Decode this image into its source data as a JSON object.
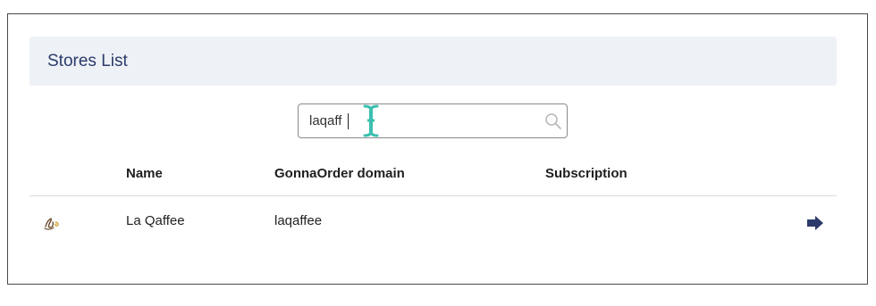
{
  "header": {
    "title": "Stores List"
  },
  "search": {
    "value": "laqaff",
    "placeholder": "",
    "icon": "search-icon"
  },
  "table": {
    "columns": [
      "",
      "Name",
      "GonnaOrder domain",
      "Subscription",
      ""
    ],
    "rows": [
      {
        "logo": "store-logo",
        "name": "La Qaffee",
        "domain": "laqaffee",
        "subscription": "",
        "action_icon": "arrow-right-icon"
      }
    ]
  },
  "colors": {
    "header_bg": "#eef2f6",
    "header_text": "#2b3a6b",
    "arrow": "#2b3a6b",
    "cursor": "#3bbfb0"
  }
}
